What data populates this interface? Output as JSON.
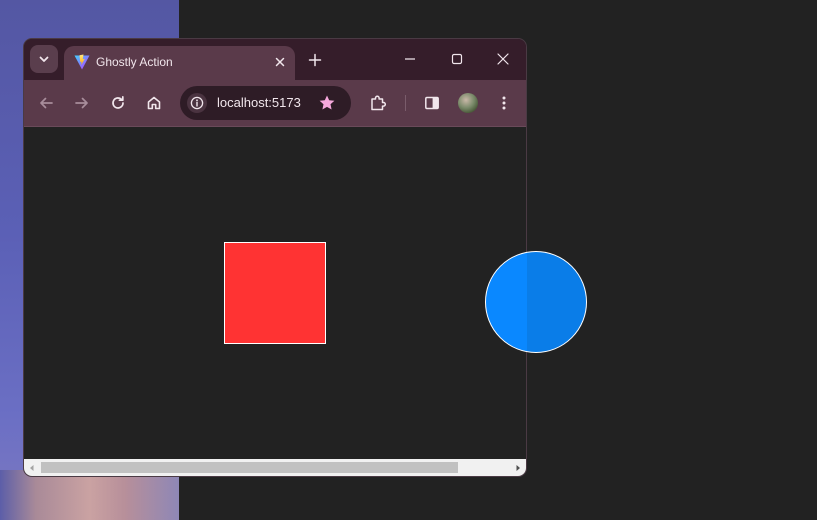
{
  "browser": {
    "tab_title": "Ghostly Action",
    "url": "localhost:5173",
    "tab_close_icon": "close-icon",
    "new_tab_icon": "plus-icon"
  },
  "window_controls": {
    "minimize_icon": "minimize-icon",
    "maximize_icon": "maximize-icon",
    "close_icon": "close-icon"
  },
  "toolbar": {
    "back_icon": "back-arrow-icon",
    "forward_icon": "forward-arrow-icon",
    "reload_icon": "reload-icon",
    "home_icon": "home-icon",
    "site_info_icon": "info-icon",
    "bookmark_icon": "star-icon",
    "extensions_icon": "puzzle-icon",
    "side_panel_icon": "side-panel-icon",
    "menu_icon": "more-vertical-icon"
  },
  "page": {
    "shapes": [
      {
        "kind": "square",
        "color": "#ff3333"
      },
      {
        "kind": "circle",
        "color": "#0a88ff"
      }
    ]
  },
  "colors": {
    "titlebar": "#351d2a",
    "toolbar": "#5a3a4a",
    "page_background": "#222222",
    "bookmark_star": "#f6a8dc"
  }
}
